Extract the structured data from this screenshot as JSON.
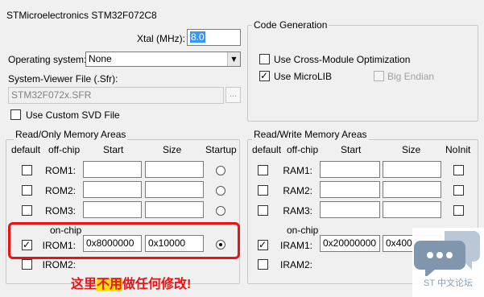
{
  "device": "STMicroelectronics STM32F072C8",
  "xtal": {
    "label": "Xtal (MHz):",
    "value": "8.0"
  },
  "os": {
    "label": "Operating system:",
    "value": "None"
  },
  "sysviewer": {
    "label": "System-Viewer File (.Sfr):",
    "value": "STM32F072x.SFR",
    "browse": "..."
  },
  "svd": {
    "label": "Use Custom SVD File",
    "checked": false
  },
  "codegen": {
    "title": "Code Generation",
    "cross_module": {
      "label": "Use Cross-Module Optimization",
      "checked": false
    },
    "microlib": {
      "label": "Use MicroLIB",
      "checked": true
    },
    "big_endian": {
      "label": "Big Endian",
      "checked": false
    }
  },
  "rom": {
    "title": "Read/Only Memory Areas",
    "columns": {
      "default": "default",
      "offchip": "off-chip",
      "start": "Start",
      "size": "Size",
      "startup": "Startup"
    },
    "onchip_label": "on-chip",
    "rows": [
      {
        "name": "ROM1:",
        "start": "",
        "size": "",
        "default": false,
        "startup": false
      },
      {
        "name": "ROM2:",
        "start": "",
        "size": "",
        "default": false,
        "startup": false
      },
      {
        "name": "ROM3:",
        "start": "",
        "size": "",
        "default": false,
        "startup": false
      },
      {
        "name": "IROM1:",
        "start": "0x8000000",
        "size": "0x10000",
        "default": true,
        "startup": true
      },
      {
        "name": "IROM2:",
        "start": "",
        "size": "",
        "default": false,
        "startup": false
      }
    ]
  },
  "ram": {
    "title": "Read/Write Memory Areas",
    "columns": {
      "default": "default",
      "offchip": "off-chip",
      "start": "Start",
      "size": "Size",
      "noinit": "NoInit"
    },
    "onchip_label": "on-chip",
    "rows": [
      {
        "name": "RAM1:",
        "start": "",
        "size": "",
        "default": false,
        "noinit": false
      },
      {
        "name": "RAM2:",
        "start": "",
        "size": "",
        "default": false,
        "noinit": false
      },
      {
        "name": "RAM3:",
        "start": "",
        "size": "",
        "default": false,
        "noinit": false
      },
      {
        "name": "IRAM1:",
        "start": "0x20000000",
        "size": "0x4000",
        "default": true,
        "noinit": false
      },
      {
        "name": "IRAM2:",
        "start": "",
        "size": "",
        "default": false,
        "noinit": false
      }
    ]
  },
  "annotation": {
    "before": "这里",
    "highlight": "不用",
    "after": "做任何修改!"
  },
  "watermark": {
    "text": "ST 中文论坛"
  },
  "colors": {
    "annotation": "#ee1111",
    "highlight": "#ffe000",
    "selection": "#3399ff"
  }
}
